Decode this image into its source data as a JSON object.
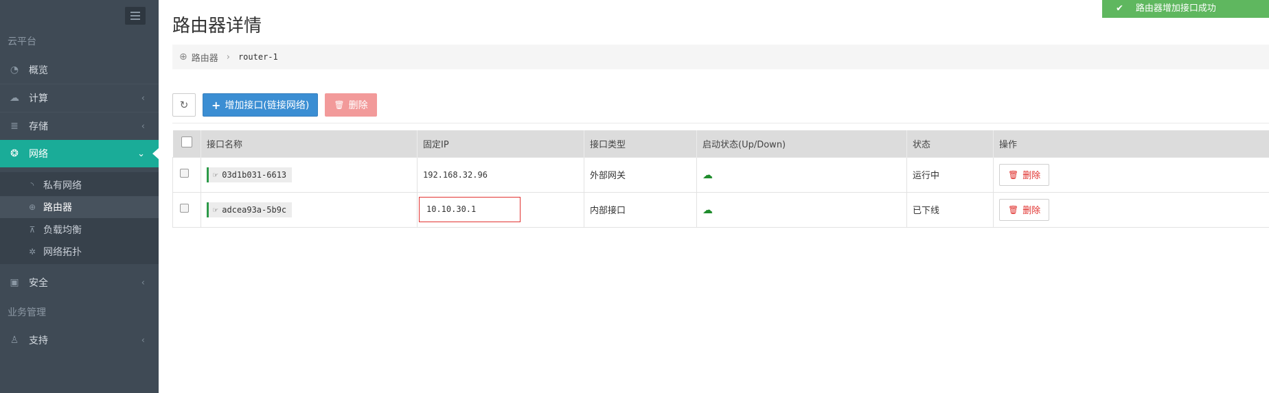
{
  "sidebar": {
    "section_cloud": "云平台",
    "section_business": "业务管理",
    "items": [
      {
        "label": "概览",
        "icon": "dashboard-icon"
      },
      {
        "label": "计算",
        "icon": "cloud-icon"
      },
      {
        "label": "存储",
        "icon": "database-icon"
      },
      {
        "label": "网络",
        "icon": "network-icon"
      },
      {
        "label": "安全",
        "icon": "medkit-icon"
      },
      {
        "label": "支持",
        "icon": "support-icon"
      }
    ],
    "network_sub": [
      {
        "label": "私有网络",
        "icon": "rss-icon"
      },
      {
        "label": "路由器",
        "icon": "globe-icon"
      },
      {
        "label": "负载均衡",
        "icon": "sitemap-icon"
      },
      {
        "label": "网络拓扑",
        "icon": "gear-icon"
      }
    ]
  },
  "header": {
    "title": "路由器详情"
  },
  "breadcrumb": {
    "parent": "路由器",
    "current": "router-1"
  },
  "toolbar": {
    "add_label": "增加接口(链接网络)",
    "delete_label": "删除"
  },
  "table": {
    "columns": [
      "接口名称",
      "固定IP",
      "接口类型",
      "启动状态(Up/Down)",
      "状态",
      "操作"
    ],
    "rows": [
      {
        "name": "03d1b031-6613",
        "ip": "192.168.32.96",
        "type": "外部网关",
        "status": "运行中",
        "action": "删除"
      },
      {
        "name": "adcea93a-5b9c",
        "ip": "10.10.30.1",
        "type": "内部接口",
        "status": "已下线",
        "action": "删除"
      }
    ]
  },
  "toast": {
    "message": "路由器增加接口成功"
  },
  "colors": {
    "sidebar_bg": "#3f4a55",
    "active_nav": "#1aac98",
    "primary": "#3b8ed3",
    "danger_light": "#f29a9a",
    "success": "#5fb75f",
    "highlight": "#e2312f"
  }
}
